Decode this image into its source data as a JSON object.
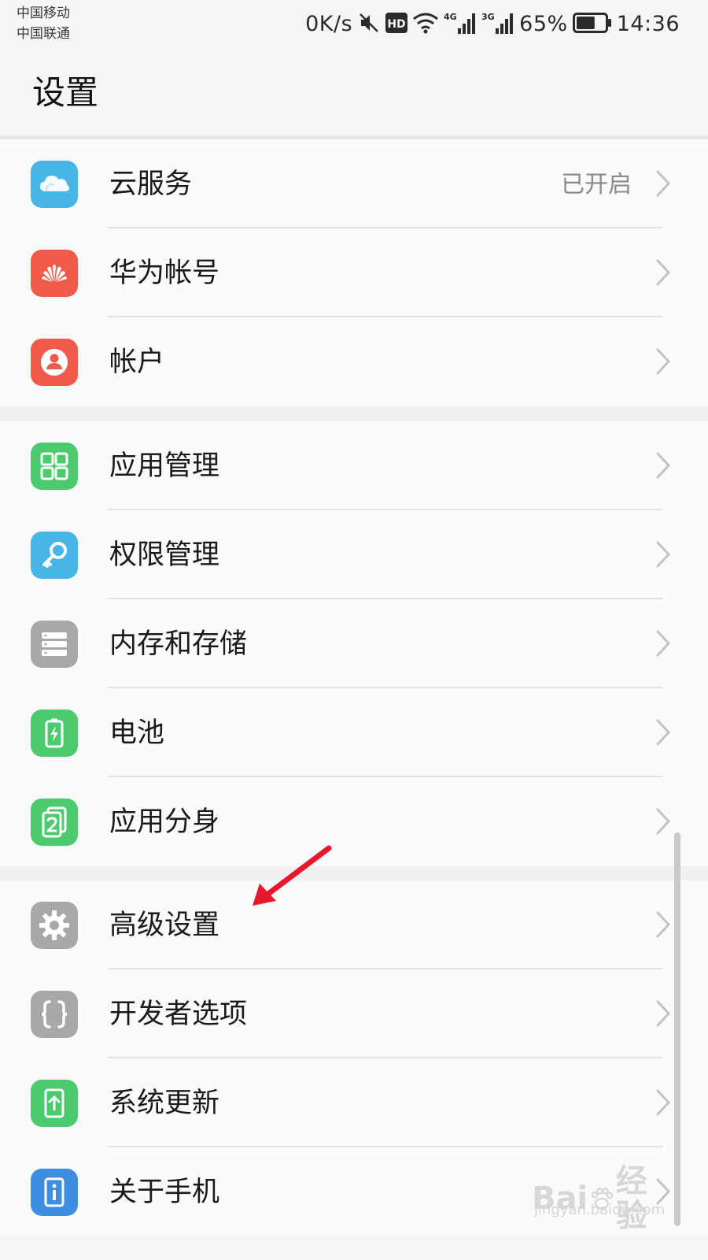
{
  "status_bar": {
    "carrier_1": "中国移动",
    "carrier_2": "中国联通",
    "net_speed": "0K/s",
    "hd_badge": "HD",
    "net_4g": "4G",
    "net_3g": "3G",
    "battery_percent": "65%",
    "battery_level": 0.65,
    "time": "14:36",
    "icons": [
      "mute-icon",
      "hd-icon",
      "wifi-icon",
      "signal-4g-icon",
      "signal-3g-icon",
      "battery-icon"
    ]
  },
  "header": {
    "title": "设置"
  },
  "groups": [
    {
      "items": [
        {
          "label": "云服务",
          "value": "已开启",
          "icon": "cloud-icon",
          "color": "#45b6e6"
        },
        {
          "label": "华为帐号",
          "icon": "huawei-logo-icon",
          "color": "#f05a4a"
        },
        {
          "label": "帐户",
          "icon": "user-icon",
          "color": "#f05a4a"
        }
      ]
    },
    {
      "items": [
        {
          "label": "应用管理",
          "icon": "grid-icon",
          "color": "#4cca6e"
        },
        {
          "label": "权限管理",
          "icon": "key-icon",
          "color": "#45b6e6"
        },
        {
          "label": "内存和存储",
          "icon": "storage-icon",
          "color": "#a8a8a8"
        },
        {
          "label": "电池",
          "icon": "battery-charge-icon",
          "color": "#4cca6e"
        },
        {
          "label": "应用分身",
          "icon": "app-twin-icon",
          "color": "#4cca6e"
        }
      ]
    },
    {
      "items": [
        {
          "label": "高级设置",
          "icon": "gear-icon",
          "color": "#a8a8a8"
        },
        {
          "label": "开发者选项",
          "icon": "braces-icon",
          "color": "#a8a8a8"
        },
        {
          "label": "系统更新",
          "icon": "update-icon",
          "color": "#4cca6e"
        },
        {
          "label": "关于手机",
          "icon": "info-icon",
          "color": "#3d8ee0"
        }
      ]
    }
  ],
  "annotation": {
    "arrow_color": "#e8172c"
  },
  "watermark": {
    "brand_left": "Bai",
    "brand_right": "经验",
    "url": "jingyan.baidu.com"
  }
}
